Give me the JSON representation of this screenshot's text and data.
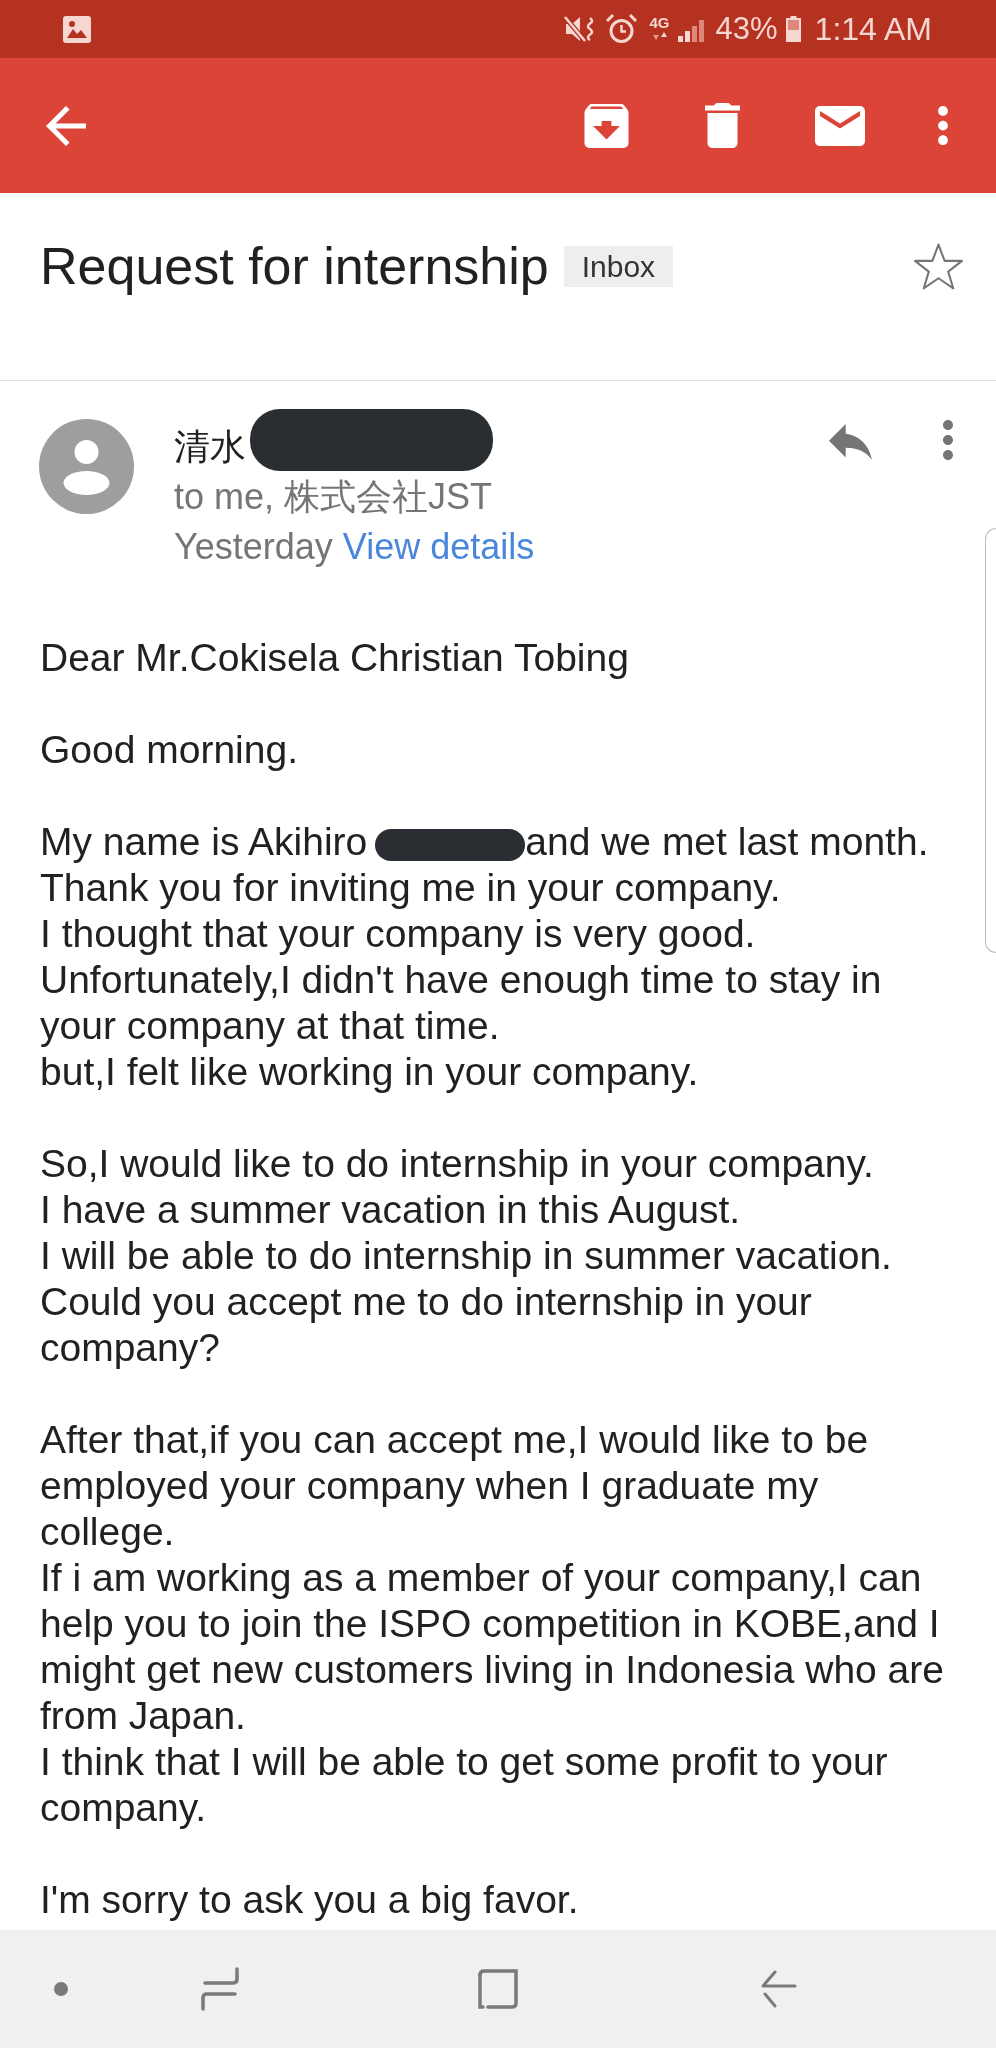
{
  "status_bar": {
    "network": "4G",
    "battery": "43%",
    "time": "1:14 AM"
  },
  "message": {
    "subject": "Request for internship",
    "label": "Inbox",
    "starred": false,
    "sender": {
      "name": "清水",
      "redacted": true
    },
    "recipients": "to me, 株式会社JST",
    "date": "Yesterday",
    "details_link": "View details",
    "body": [
      [
        {
          "kind": "text",
          "text": "Dear Mr.Cokisela Christian Tobing"
        }
      ],
      [
        {
          "kind": "text",
          "text": "Good morning."
        }
      ],
      [
        {
          "kind": "redacted",
          "before": "My name is Akihiro",
          "after": "and we met last month."
        },
        {
          "kind": "text",
          "text": "Thank you for inviting me in your company."
        },
        {
          "kind": "text",
          "text": "I thought that your company is very good."
        },
        {
          "kind": "text",
          "text": "Unfortunately,I didn't have enough time to stay in your company at that time."
        },
        {
          "kind": "text",
          "text": "but,I felt like working in your company."
        }
      ],
      [
        {
          "kind": "text",
          "text": "So,I would like to do internship in your company."
        },
        {
          "kind": "text",
          "text": "I have a summer vacation in this August."
        },
        {
          "kind": "text",
          "text": "I will be able to do internship in summer vacation."
        },
        {
          "kind": "text",
          "text": "Could you accept me to do internship in your company?"
        }
      ],
      [
        {
          "kind": "text",
          "text": "After that,if you can accept me,I would like to be employed your company when I graduate my college."
        },
        {
          "kind": "text",
          "text": "If i am working as a member of your company,I can help you to join the ISPO competition in KOBE,and I might get new customers living in Indonesia who are from Japan."
        },
        {
          "kind": "text",
          "text": "I think that I will be able to get some profit to your company."
        }
      ],
      [
        {
          "kind": "text",
          "text": "I'm sorry to ask you a big favor."
        }
      ]
    ]
  }
}
